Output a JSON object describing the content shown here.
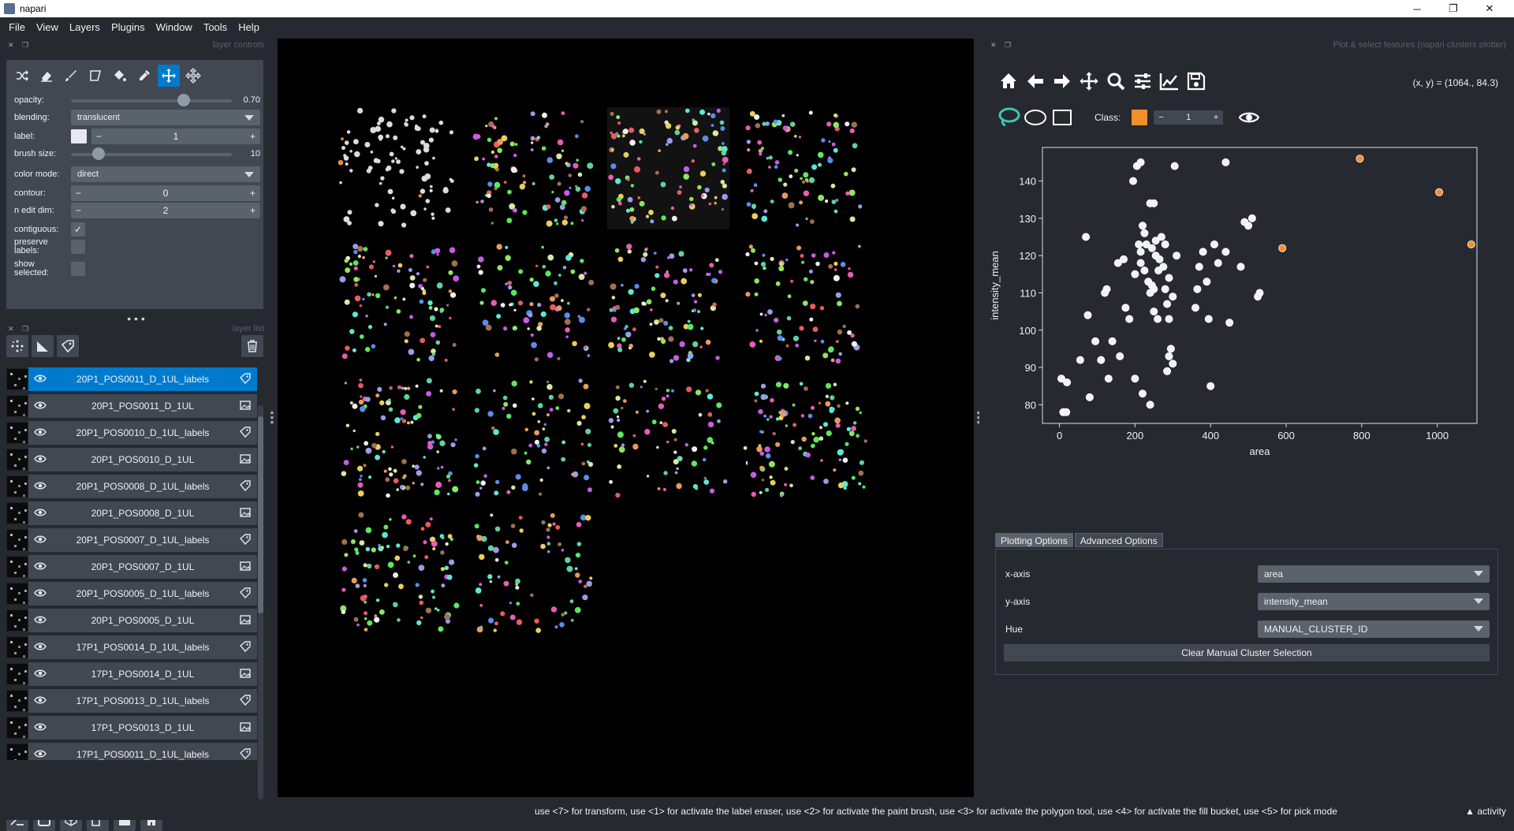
{
  "window": {
    "title": "napari",
    "minimize": "─",
    "maximize": "❐",
    "close": "✕"
  },
  "menu": [
    "File",
    "View",
    "Layers",
    "Plugins",
    "Window",
    "Tools",
    "Help"
  ],
  "layer_controls": {
    "header": "layer controls",
    "opacity_label": "opacity:",
    "opacity_value": "0.70",
    "opacity_level": 0.7,
    "blending_label": "blending:",
    "blending_value": "translucent",
    "label_label": "label:",
    "label_value": "1",
    "brush_label": "brush size:",
    "brush_value": "10",
    "brush_level": 0.17,
    "colormode_label": "color mode:",
    "colormode_value": "direct",
    "contour_label": "contour:",
    "contour_value": "0",
    "ndim_label": "n edit dim:",
    "ndim_value": "2",
    "contiguous_label": "contiguous:",
    "contiguous_checked": "✓",
    "preserve_label": "preserve labels:",
    "show_label": "show selected:"
  },
  "layer_list": {
    "header": "layer list",
    "layers": [
      {
        "name": "20P1_POS0011_D_1UL_labels",
        "type": "labels",
        "selected": true
      },
      {
        "name": "20P1_POS0011_D_1UL",
        "type": "image"
      },
      {
        "name": "20P1_POS0010_D_1UL_labels",
        "type": "labels"
      },
      {
        "name": "20P1_POS0010_D_1UL",
        "type": "image"
      },
      {
        "name": "20P1_POS0008_D_1UL_labels",
        "type": "labels"
      },
      {
        "name": "20P1_POS0008_D_1UL",
        "type": "image"
      },
      {
        "name": "20P1_POS0007_D_1UL_labels",
        "type": "labels"
      },
      {
        "name": "20P1_POS0007_D_1UL",
        "type": "image"
      },
      {
        "name": "20P1_POS0005_D_1UL_labels",
        "type": "labels"
      },
      {
        "name": "20P1_POS0005_D_1UL",
        "type": "image"
      },
      {
        "name": "17P1_POS0014_D_1UL_labels",
        "type": "labels"
      },
      {
        "name": "17P1_POS0014_D_1UL",
        "type": "image"
      },
      {
        "name": "17P1_POS0013_D_1UL_labels",
        "type": "labels"
      },
      {
        "name": "17P1_POS0013_D_1UL",
        "type": "image"
      },
      {
        "name": "17P1_POS0011_D_1UL_labels",
        "type": "labels"
      }
    ]
  },
  "plotter": {
    "header": "Plot & select features (napari clusters plotter)",
    "coords": "(x, y) = (1064., 84.3)",
    "class_label": "Class:",
    "class_value": "1",
    "tabs": [
      "Plotting Options",
      "Advanced Options"
    ],
    "xaxis_label": "x-axis",
    "xaxis_value": "area",
    "yaxis_label": "y-axis",
    "yaxis_value": "intensity_mean",
    "hue_label": "Hue",
    "hue_value": "MANUAL_CLUSTER_ID",
    "clear_button": "Clear Manual Cluster Selection"
  },
  "chart_data": {
    "type": "scatter",
    "xlabel": "area",
    "ylabel": "intensity_mean",
    "xlim": [
      -45,
      1105
    ],
    "ylim": [
      75,
      149
    ],
    "xticks": [
      0,
      200,
      400,
      600,
      800,
      1000
    ],
    "yticks": [
      80,
      90,
      100,
      110,
      120,
      130,
      140
    ],
    "colors": {
      "default": "#f0f0f8",
      "selected": "#f28e2b"
    },
    "points": [
      [
        5,
        87
      ],
      [
        20,
        86
      ],
      [
        10,
        78
      ],
      [
        18,
        78
      ],
      [
        75,
        104
      ],
      [
        70,
        125
      ],
      [
        55,
        92
      ],
      [
        80,
        82
      ],
      [
        95,
        97
      ],
      [
        110,
        92
      ],
      [
        125,
        111
      ],
      [
        120,
        110
      ],
      [
        130,
        87
      ],
      [
        140,
        97
      ],
      [
        160,
        93
      ],
      [
        155,
        118
      ],
      [
        170,
        119
      ],
      [
        175,
        106
      ],
      [
        185,
        103
      ],
      [
        195,
        140
      ],
      [
        205,
        144
      ],
      [
        215,
        145
      ],
      [
        210,
        123
      ],
      [
        215,
        121
      ],
      [
        220,
        128
      ],
      [
        225,
        126
      ],
      [
        215,
        118
      ],
      [
        230,
        123
      ],
      [
        225,
        116
      ],
      [
        200,
        115
      ],
      [
        235,
        113
      ],
      [
        245,
        112
      ],
      [
        250,
        111
      ],
      [
        240,
        110
      ],
      [
        250,
        105
      ],
      [
        260,
        103
      ],
      [
        255,
        120
      ],
      [
        265,
        119
      ],
      [
        270,
        125
      ],
      [
        245,
        122
      ],
      [
        255,
        124
      ],
      [
        262,
        116
      ],
      [
        280,
        123
      ],
      [
        275,
        117
      ],
      [
        280,
        111
      ],
      [
        285,
        107
      ],
      [
        290,
        114
      ],
      [
        290,
        103
      ],
      [
        300,
        109
      ],
      [
        295,
        95
      ],
      [
        290,
        93
      ],
      [
        300,
        91
      ],
      [
        285,
        89
      ],
      [
        250,
        134
      ],
      [
        240,
        134
      ],
      [
        310,
        120
      ],
      [
        305,
        144
      ],
      [
        360,
        106
      ],
      [
        365,
        111
      ],
      [
        390,
        113
      ],
      [
        380,
        121
      ],
      [
        370,
        117
      ],
      [
        395,
        103
      ],
      [
        400,
        85
      ],
      [
        410,
        123
      ],
      [
        420,
        118
      ],
      [
        440,
        121
      ],
      [
        450,
        102
      ],
      [
        480,
        117
      ],
      [
        510,
        130
      ],
      [
        500,
        128
      ],
      [
        490,
        129
      ],
      [
        530,
        110
      ],
      [
        525,
        109
      ],
      [
        440,
        145
      ],
      [
        200,
        87
      ],
      [
        220,
        83
      ],
      [
        240,
        80
      ]
    ],
    "selected_points": [
      [
        590,
        122
      ],
      [
        795,
        146
      ],
      [
        1005,
        137
      ],
      [
        1090,
        123
      ]
    ]
  },
  "status": {
    "message": "use <7> for transform, use <1> for activate the label eraser, use <2> for activate the paint brush, use <3> for activate the polygon tool, use <4> for activate the fill bucket, use <5> for pick mode",
    "activity": "▲ activity"
  }
}
